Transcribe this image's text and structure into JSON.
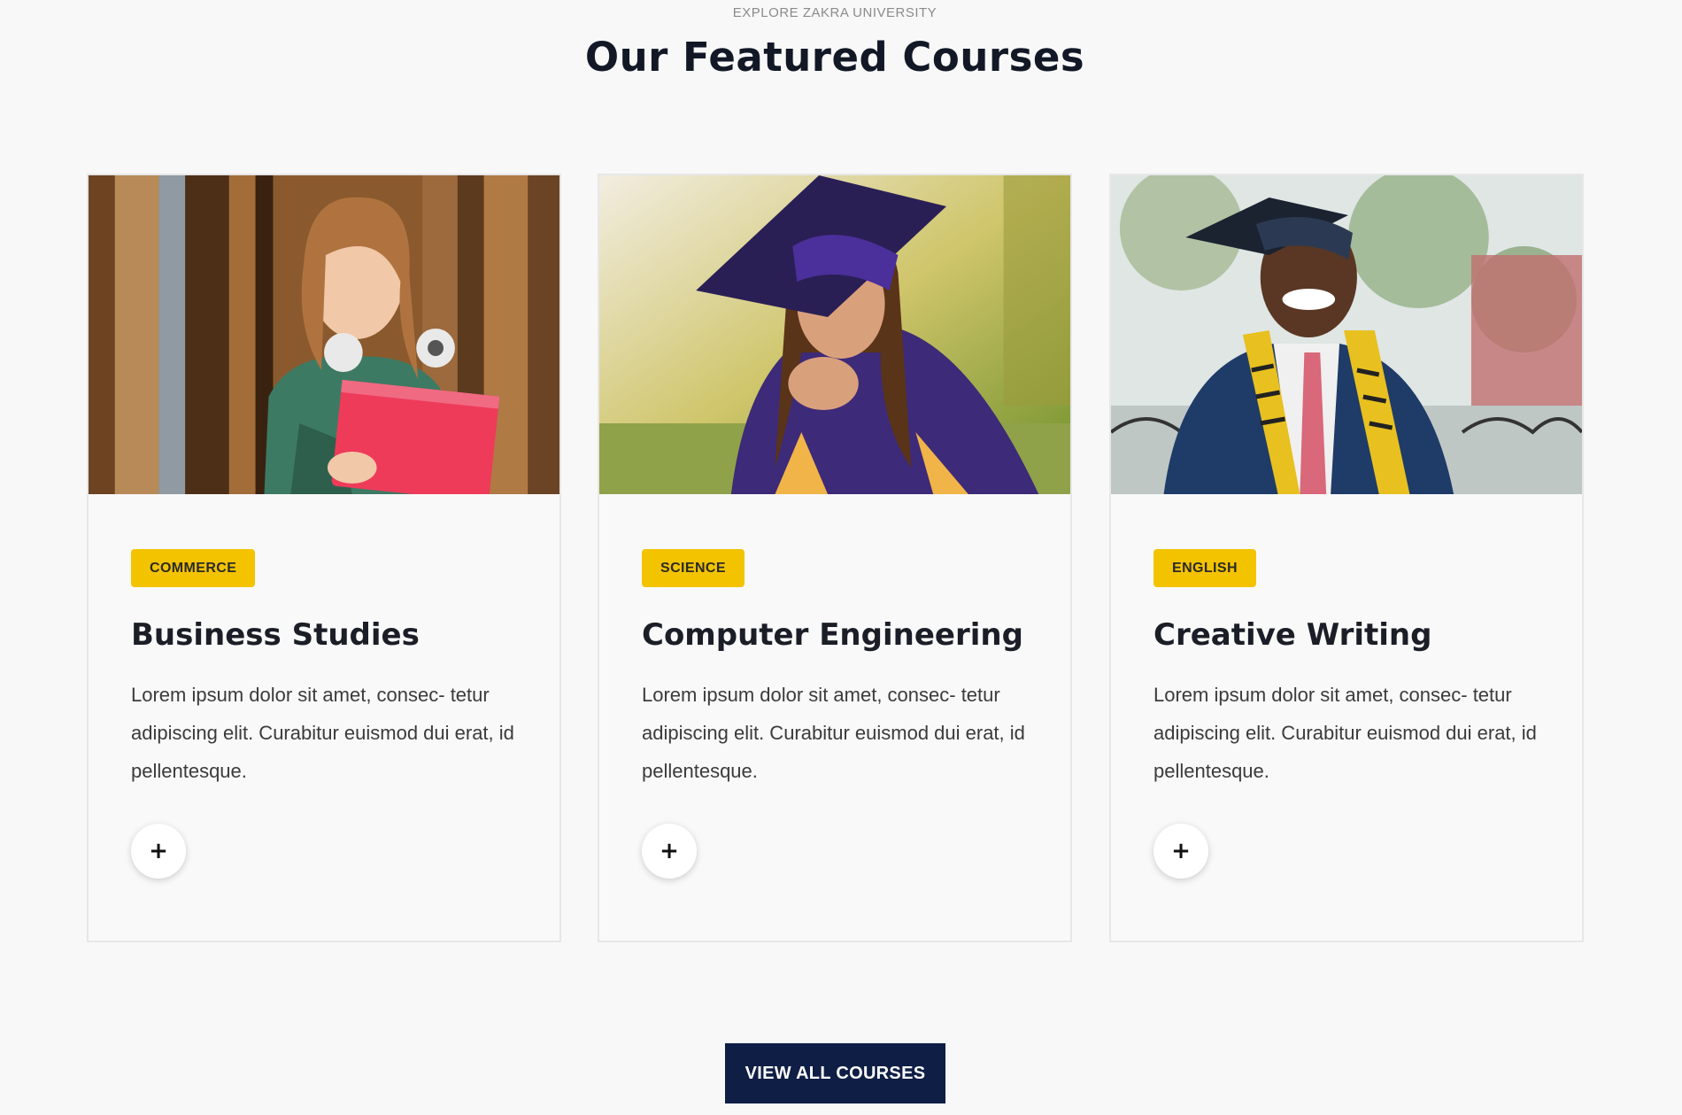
{
  "section": {
    "eyebrow": "EXPLORE ZAKRA UNIVERSITY",
    "title": "Our Featured Courses"
  },
  "courses": [
    {
      "category": "COMMERCE",
      "title": "Business Studies",
      "description": "Lorem ipsum dolor sit amet, consec- tetur adipiscing elit. Curabitur euismod dui erat, id pellentesque.",
      "image": "student-holding-red-folder-photo",
      "action_icon": "plus-icon",
      "action_symbol": "+"
    },
    {
      "category": "SCIENCE",
      "title": "Computer Engineering",
      "description": "Lorem ipsum dolor sit amet, consec- tetur adipiscing elit. Curabitur euismod dui erat, id pellentesque.",
      "image": "graduate-woman-purple-cap-photo",
      "action_icon": "plus-icon",
      "action_symbol": "+"
    },
    {
      "category": "ENGLISH",
      "title": "Creative Writing",
      "description": "Lorem ipsum dolor sit amet, consec- tetur adipiscing elit. Curabitur euismod dui erat, id pellentesque.",
      "image": "graduate-man-navy-suit-photo",
      "action_icon": "plus-icon",
      "action_symbol": "+"
    }
  ],
  "cta": {
    "label": "VIEW ALL COURSES"
  },
  "colors": {
    "accent_yellow": "#f4c300",
    "navy": "#0f1e45",
    "heading": "#121826",
    "background": "#f8f8f8"
  }
}
